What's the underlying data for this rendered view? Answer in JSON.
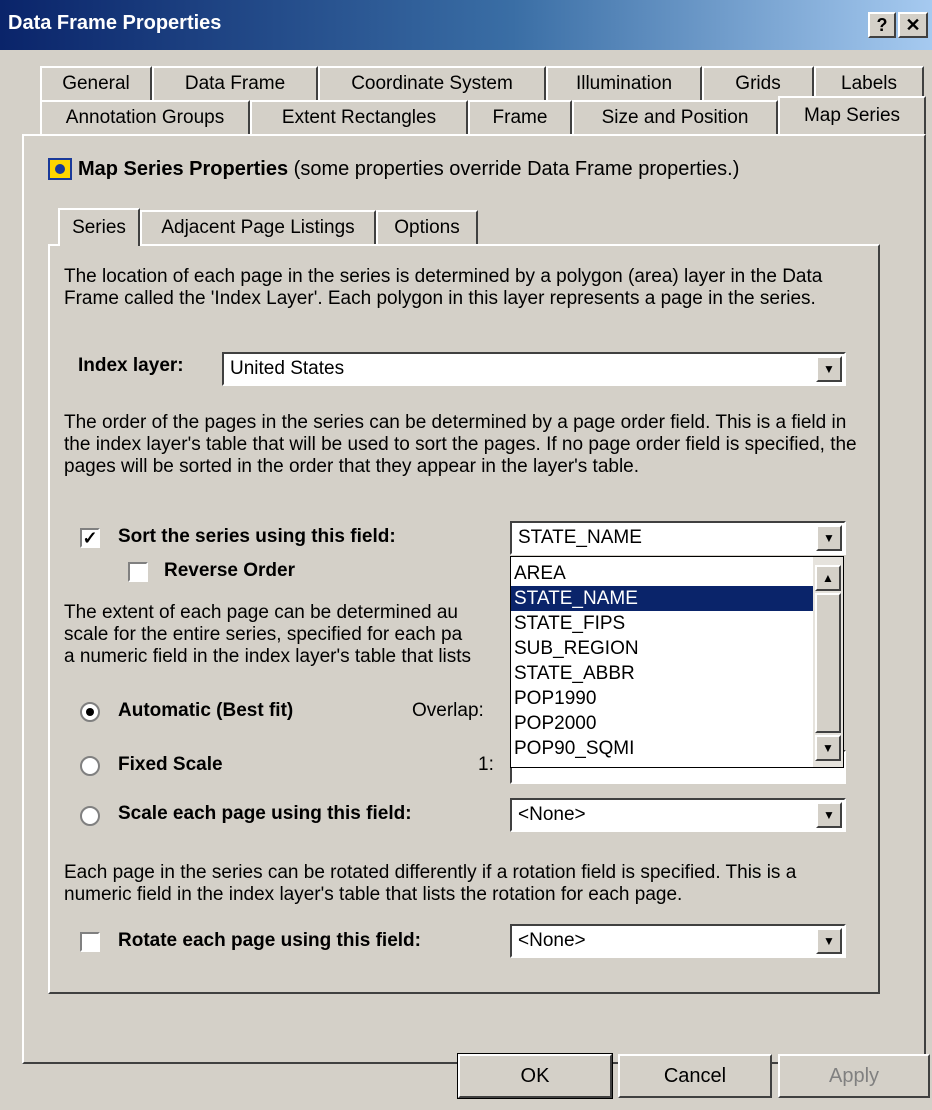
{
  "window": {
    "title": "Data Frame Properties",
    "help_label": "?",
    "close_label": "✕"
  },
  "tabs_row1": [
    "General",
    "Data Frame",
    "Coordinate System",
    "Illumination",
    "Grids",
    "Labels"
  ],
  "tabs_row2": [
    "Annotation Groups",
    "Extent Rectangles",
    "Frame",
    "Size and Position",
    "Map Series"
  ],
  "header": {
    "title": "Map Series Properties",
    "note": "(some properties override Data Frame properties.)"
  },
  "inner_tabs": [
    "Series",
    "Adjacent Page Listings",
    "Options"
  ],
  "series": {
    "index_desc": "The location of each page in the series is determined by a polygon (area) layer in the Data Frame called the 'Index Layer'.  Each polygon in this layer represents a page in the series.",
    "index_label": "Index layer:",
    "index_value": "United States",
    "order_desc": "The order of the pages in the series can be determined by a page order field.  This is a field in the index layer's table that will be used to sort the pages.  If no page order field is specified, the pages will be sorted in the order that they appear in the layer's table.",
    "sort_label": "Sort the series using this field:",
    "sort_checked": true,
    "sort_value": "STATE_NAME",
    "reverse_label": "Reverse Order",
    "reverse_checked": false,
    "extent_desc_lines": [
      "The extent of each page can be determined au",
      "scale for the entire series, specified for each pa",
      "a numeric field in the index layer's table that lists"
    ],
    "auto_label": "Automatic (Best fit)",
    "overlap_label": "Overlap:",
    "fixed_label": "Fixed Scale",
    "ratio_label": "1:",
    "scale_field_label": "Scale each page using this field:",
    "scale_field_value": "<None>",
    "selected_extent_option": "Automatic (Best fit)",
    "rotation_desc": "Each page in the series can be rotated differently if a rotation field is specified.  This is a numeric field in the index layer's table that lists the rotation for each page.",
    "rotate_label": "Rotate each page using this field:",
    "rotate_checked": false,
    "rotate_value": "<None>"
  },
  "sort_dropdown_options": [
    "AREA",
    "STATE_NAME",
    "STATE_FIPS",
    "SUB_REGION",
    "STATE_ABBR",
    "POP1990",
    "POP2000",
    "POP90_SQMI"
  ],
  "sort_dropdown_selected": "STATE_NAME",
  "buttons": {
    "ok": "OK",
    "cancel": "Cancel",
    "apply": "Apply"
  },
  "colors": {
    "face": "#d4d0c8",
    "title_bar": "#0a246a",
    "selection": "#0a246a",
    "disabled_text": "#808080"
  }
}
